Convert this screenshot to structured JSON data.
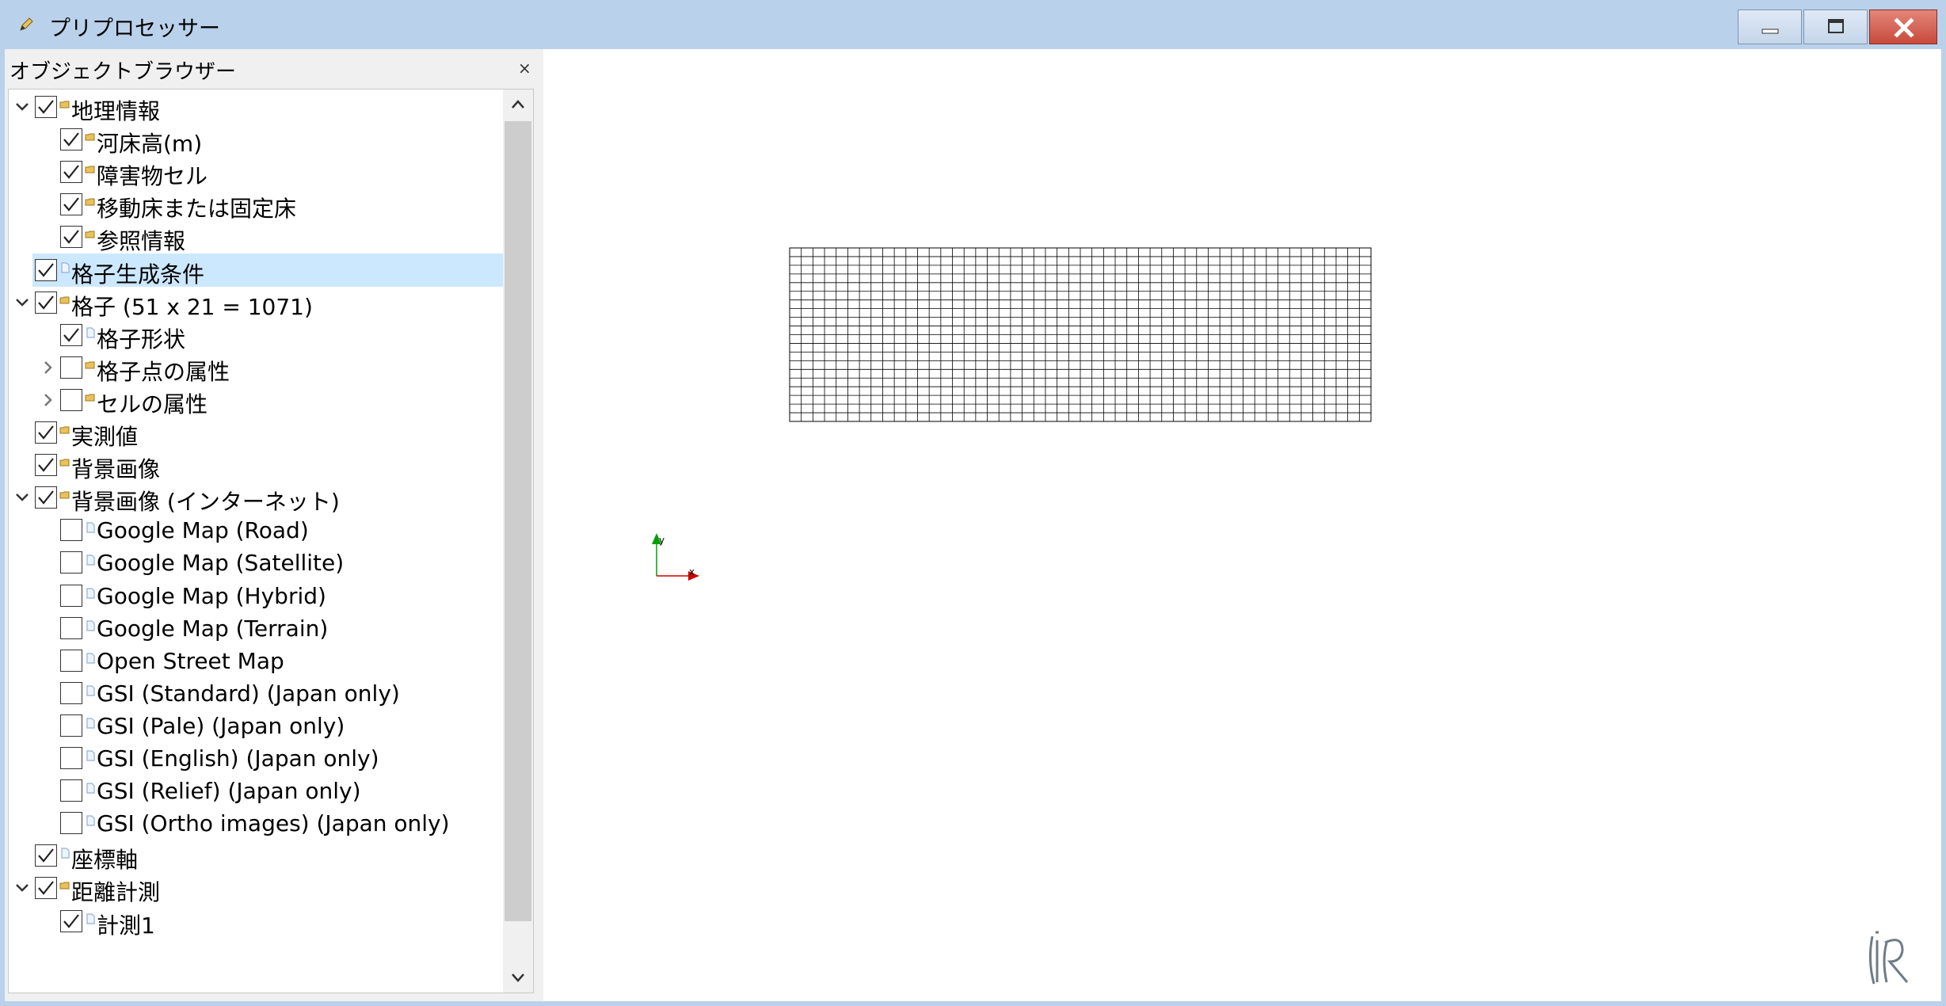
{
  "window": {
    "title": "プリプロセッサー",
    "icons": {
      "app": "pencil-icon",
      "minimize": "minimize-icon",
      "maximize": "maximize-icon",
      "close": "close-icon"
    }
  },
  "object_browser": {
    "title": "オブジェクトブラウザー",
    "close_glyph": "×",
    "items": [
      {
        "label": "地理情報",
        "level": 0,
        "expander": "expanded",
        "checked": true,
        "icon": "folder-icon"
      },
      {
        "label": "河床高(m)",
        "level": 1,
        "expander": "none",
        "checked": true,
        "icon": "folder-icon"
      },
      {
        "label": "障害物セル",
        "level": 1,
        "expander": "none",
        "checked": true,
        "icon": "folder-icon"
      },
      {
        "label": "移動床または固定床",
        "level": 1,
        "expander": "none",
        "checked": true,
        "icon": "folder-icon"
      },
      {
        "label": "参照情報",
        "level": 1,
        "expander": "none",
        "checked": true,
        "icon": "folder-icon"
      },
      {
        "label": "格子生成条件",
        "level": 0,
        "expander": "none",
        "checked": true,
        "icon": "document-icon",
        "selected": true
      },
      {
        "label": "格子 (51 x 21 = 1071)",
        "level": 0,
        "expander": "expanded",
        "checked": true,
        "icon": "folder-icon"
      },
      {
        "label": "格子形状",
        "level": 1,
        "expander": "none",
        "checked": true,
        "icon": "document-icon"
      },
      {
        "label": "格子点の属性",
        "level": 1,
        "expander": "collapsed",
        "checked": false,
        "icon": "folder-icon"
      },
      {
        "label": "セルの属性",
        "level": 1,
        "expander": "collapsed",
        "checked": false,
        "icon": "folder-icon"
      },
      {
        "label": "実測値",
        "level": 0,
        "expander": "none",
        "checked": true,
        "icon": "folder-icon"
      },
      {
        "label": "背景画像",
        "level": 0,
        "expander": "none",
        "checked": true,
        "icon": "folder-icon"
      },
      {
        "label": "背景画像 (インターネット)",
        "level": 0,
        "expander": "expanded",
        "checked": true,
        "icon": "folder-icon"
      },
      {
        "label": "Google Map (Road)",
        "level": 1,
        "expander": "none",
        "checked": false,
        "icon": "document-icon"
      },
      {
        "label": "Google Map (Satellite)",
        "level": 1,
        "expander": "none",
        "checked": false,
        "icon": "document-icon"
      },
      {
        "label": "Google Map (Hybrid)",
        "level": 1,
        "expander": "none",
        "checked": false,
        "icon": "document-icon"
      },
      {
        "label": "Google Map (Terrain)",
        "level": 1,
        "expander": "none",
        "checked": false,
        "icon": "document-icon"
      },
      {
        "label": "Open Street Map",
        "level": 1,
        "expander": "none",
        "checked": false,
        "icon": "document-icon"
      },
      {
        "label": "GSI (Standard) (Japan only)",
        "level": 1,
        "expander": "none",
        "checked": false,
        "icon": "document-icon"
      },
      {
        "label": "GSI (Pale) (Japan only)",
        "level": 1,
        "expander": "none",
        "checked": false,
        "icon": "document-icon"
      },
      {
        "label": "GSI (English) (Japan only)",
        "level": 1,
        "expander": "none",
        "checked": false,
        "icon": "document-icon"
      },
      {
        "label": "GSI (Relief) (Japan only)",
        "level": 1,
        "expander": "none",
        "checked": false,
        "icon": "document-icon"
      },
      {
        "label": "GSI (Ortho images) (Japan only)",
        "level": 1,
        "expander": "none",
        "checked": false,
        "icon": "document-icon"
      },
      {
        "label": "座標軸",
        "level": 0,
        "expander": "none",
        "checked": true,
        "icon": "document-icon"
      },
      {
        "label": "距離計測",
        "level": 0,
        "expander": "expanded",
        "checked": true,
        "icon": "folder-icon"
      },
      {
        "label": "計測1",
        "level": 1,
        "expander": "none",
        "checked": true,
        "icon": "document-icon"
      }
    ]
  },
  "viewport": {
    "grid": {
      "columns": 50,
      "rows": 20
    },
    "axes": {
      "x_label": "x",
      "y_label": "y"
    },
    "colors": {
      "x_axis": "#cc0000",
      "y_axis": "#00a000",
      "grid_line": "#000000"
    },
    "logo": "ir-logo"
  },
  "colors": {
    "title_bar": "#b9d1ea",
    "selection": "#cce8ff",
    "folder": "#e8c25a",
    "document": "#8fb0d8",
    "close_button": "#c74a3b"
  }
}
